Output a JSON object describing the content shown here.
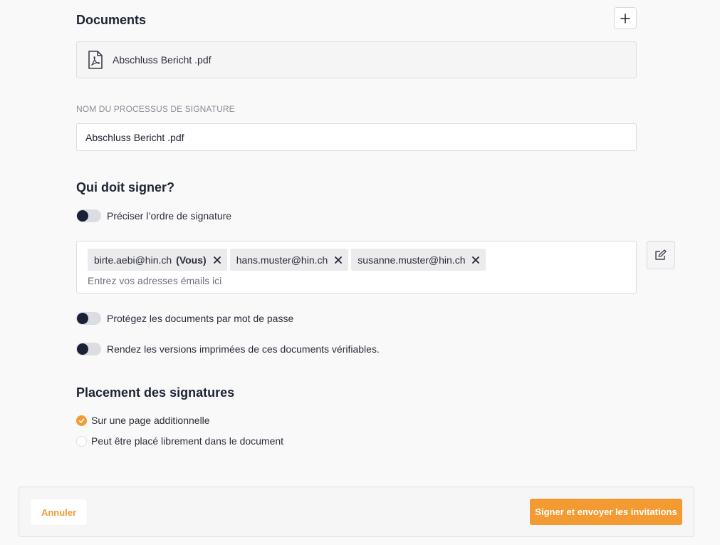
{
  "documents": {
    "title": "Documents",
    "files": [
      {
        "name": "Abschluss Bericht .pdf",
        "icon": "pdf-file-icon"
      }
    ],
    "add_icon": "plus-icon"
  },
  "process_name": {
    "label": "NOM DU PROCESSUS DE SIGNATURE",
    "value": "Abschluss Bericht .pdf"
  },
  "signers": {
    "title": "Qui doit signer?",
    "order_toggle": {
      "label": "Préciser l’ordre de signature",
      "on": false
    },
    "chips": [
      {
        "email": "birte.aebi@hin.ch",
        "tag": "(Vous)"
      },
      {
        "email": "hans.muster@hin.ch",
        "tag": ""
      },
      {
        "email": "susanne.muster@hin.ch",
        "tag": ""
      }
    ],
    "input_placeholder": "Entrez vos adresses émails ici",
    "edit_icon": "edit-list-icon"
  },
  "options": {
    "password_toggle": {
      "label": "Protégez les documents par mot de passe",
      "on": false
    },
    "verifiable_toggle": {
      "label": "Rendez les versions imprimées de ces documents vérifiables.",
      "on": false
    }
  },
  "placement": {
    "title": "Placement des signatures",
    "options": [
      {
        "label": "Sur une page additionnelle",
        "checked": true
      },
      {
        "label": "Peut être placé librement dans le document",
        "checked": false
      }
    ]
  },
  "footer": {
    "cancel_label": "Annuler",
    "submit_label": "Signer et envoyer les invitations"
  },
  "colors": {
    "accent": "#f39a32",
    "toggle_knob": "#1a2137",
    "heading": "#1d2333"
  }
}
